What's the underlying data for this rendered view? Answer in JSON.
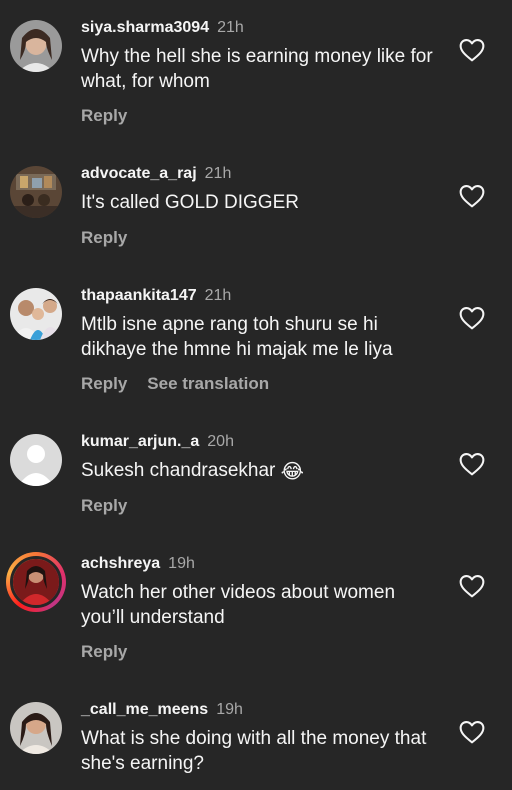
{
  "icons": {
    "like": "heart-outline-icon",
    "laugh": "face-with-tears-of-joy-emoji"
  },
  "colors": {
    "background": "#262626",
    "text": "#f5f5f5",
    "muted": "#a8a8a8",
    "story_ring": "#e1306c"
  },
  "comments": [
    {
      "username": "siya.sharma3094",
      "time": "21h",
      "text": "Why the hell she is earning money like for what, for whom",
      "reply": "Reply"
    },
    {
      "username": "advocate_a_raj",
      "time": "21h",
      "text": "It's called GOLD DIGGER",
      "reply": "Reply"
    },
    {
      "username": "thapaankita147",
      "time": "21h",
      "text": "Mtlb isne apne rang toh shuru se hi dikhaye the hmne hi majak me le liya",
      "reply": "Reply",
      "translation": "See translation"
    },
    {
      "username": "kumar_arjun._a",
      "time": "20h",
      "text": "Sukesh chandrasekhar",
      "emoji": "😂",
      "reply": "Reply"
    },
    {
      "username": "achshreya",
      "time": "19h",
      "text": "Watch her other videos about women you’ll understand",
      "reply": "Reply"
    },
    {
      "username": "_call_me_meens",
      "time": "19h",
      "text": "What is she doing with all the money that she's earning?"
    }
  ]
}
